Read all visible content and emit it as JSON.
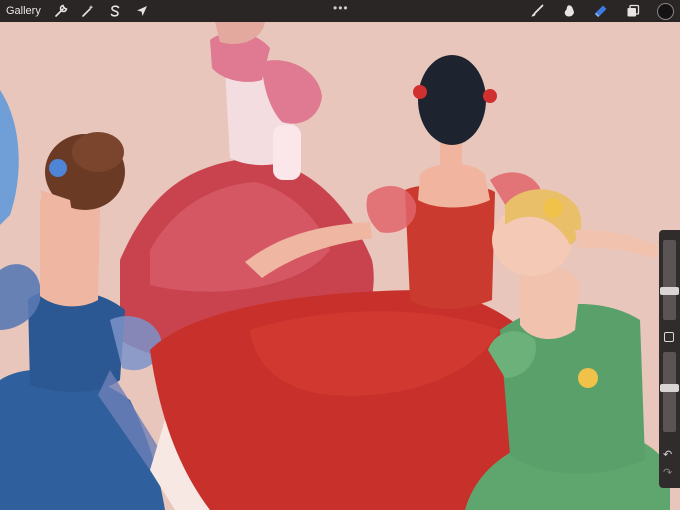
{
  "topbar": {
    "gallery_label": "Gallery",
    "left_tools": [
      {
        "icon": "wrench-icon",
        "name": "actions"
      },
      {
        "icon": "magic-wand-icon",
        "name": "adjustments"
      },
      {
        "icon": "selection-s-icon",
        "name": "selection"
      },
      {
        "icon": "arrow-cursor-icon",
        "name": "transform"
      }
    ],
    "more_label": "•••",
    "right_tools": [
      {
        "icon": "brush-icon",
        "name": "brush"
      },
      {
        "icon": "smudge-icon",
        "name": "smudge"
      },
      {
        "icon": "eraser-icon",
        "name": "eraser"
      },
      {
        "icon": "layers-icon",
        "name": "layers"
      }
    ],
    "active_color": "#151313",
    "eraser_color": "#3d7be0"
  },
  "sidebar": {
    "undo_glyph": "↶",
    "redo_glyph": "↷",
    "brush_size_level": 0.35,
    "opacity_level": 0.55
  },
  "colors": {
    "background": "#e9c6bb",
    "toolbar": "#2a2626",
    "red_dress": "#c8312b",
    "pink_dress": "#c9434f",
    "blue_dress": "#2f5f9c",
    "green_dress": "#5fa66e"
  }
}
